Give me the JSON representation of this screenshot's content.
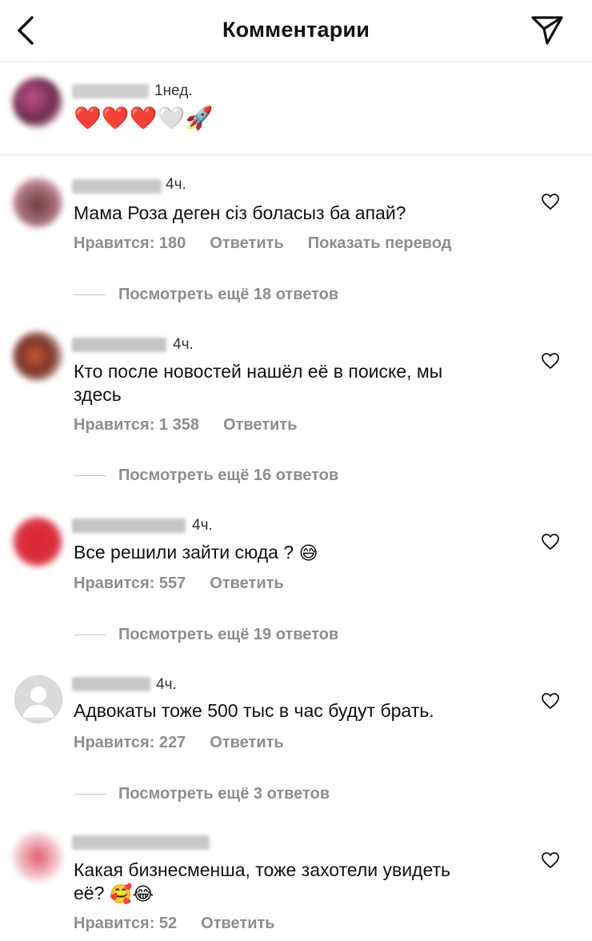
{
  "header": {
    "title": "Комментарии",
    "back_icon": "chevron-left-icon",
    "send_icon": "paper-plane-icon"
  },
  "caption": {
    "time": "1нед.",
    "hearts": [
      "❤️",
      "❤️",
      "❤️",
      "🤍"
    ],
    "rocket": "🚀"
  },
  "comments": [
    {
      "time": "4ч.",
      "text_lines": [
        "Мама Роза деген сіз боласыз ба апай?"
      ],
      "likes": "Нравится: 180",
      "reply": "Ответить",
      "translate": "Показать перевод",
      "more_replies": "Посмотреть ещё 18 ответов"
    },
    {
      "time": "4ч.",
      "text_lines": [
        "Кто после новостей нашёл её в поиске, мы",
        "здесь"
      ],
      "likes": "Нравится: 1 358",
      "reply": "Ответить",
      "more_replies": "Посмотреть ещё 16 ответов"
    },
    {
      "time": "4ч.",
      "text_lines": [
        "Все решили зайти сюда ?"
      ],
      "emoji": "😅",
      "likes": "Нравится: 557",
      "reply": "Ответить",
      "more_replies": "Посмотреть ещё 19 ответов"
    },
    {
      "time": "4ч.",
      "text_lines": [
        "Адвокаты тоже 500 тыс в час будут брать."
      ],
      "likes": "Нравится: 227",
      "reply": "Ответить",
      "more_replies": "Посмотреть ещё 3 ответов"
    },
    {
      "time": "",
      "text_lines": [
        "Какая бизнесменша, тоже захотели увидеть",
        "её?"
      ],
      "emoji": "🥰😂",
      "likes": "Нравится: 52",
      "reply": "Ответить"
    }
  ]
}
